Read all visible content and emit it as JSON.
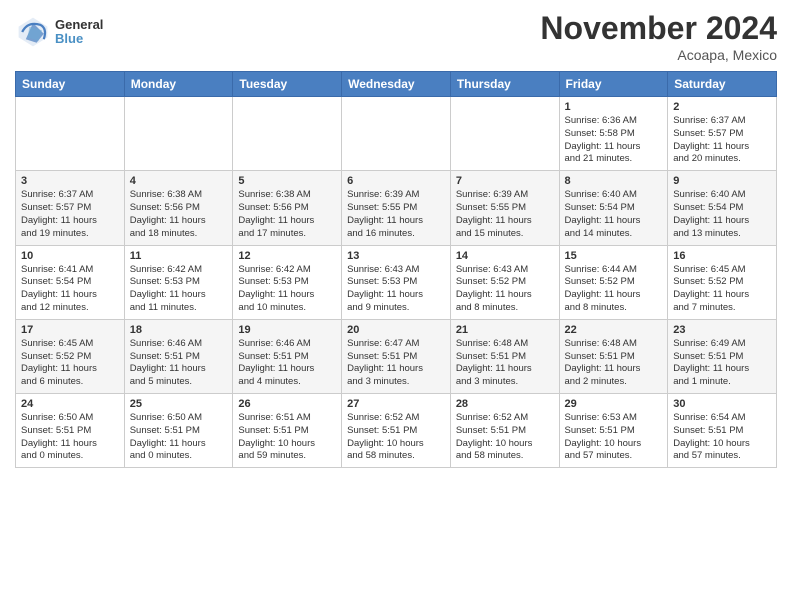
{
  "header": {
    "logo_line1": "General",
    "logo_line2": "Blue",
    "month": "November 2024",
    "location": "Acoapa, Mexico"
  },
  "weekdays": [
    "Sunday",
    "Monday",
    "Tuesday",
    "Wednesday",
    "Thursday",
    "Friday",
    "Saturday"
  ],
  "rows": [
    [
      {
        "day": "",
        "info": ""
      },
      {
        "day": "",
        "info": ""
      },
      {
        "day": "",
        "info": ""
      },
      {
        "day": "",
        "info": ""
      },
      {
        "day": "",
        "info": ""
      },
      {
        "day": "1",
        "info": "Sunrise: 6:36 AM\nSunset: 5:58 PM\nDaylight: 11 hours\nand 21 minutes."
      },
      {
        "day": "2",
        "info": "Sunrise: 6:37 AM\nSunset: 5:57 PM\nDaylight: 11 hours\nand 20 minutes."
      }
    ],
    [
      {
        "day": "3",
        "info": "Sunrise: 6:37 AM\nSunset: 5:57 PM\nDaylight: 11 hours\nand 19 minutes."
      },
      {
        "day": "4",
        "info": "Sunrise: 6:38 AM\nSunset: 5:56 PM\nDaylight: 11 hours\nand 18 minutes."
      },
      {
        "day": "5",
        "info": "Sunrise: 6:38 AM\nSunset: 5:56 PM\nDaylight: 11 hours\nand 17 minutes."
      },
      {
        "day": "6",
        "info": "Sunrise: 6:39 AM\nSunset: 5:55 PM\nDaylight: 11 hours\nand 16 minutes."
      },
      {
        "day": "7",
        "info": "Sunrise: 6:39 AM\nSunset: 5:55 PM\nDaylight: 11 hours\nand 15 minutes."
      },
      {
        "day": "8",
        "info": "Sunrise: 6:40 AM\nSunset: 5:54 PM\nDaylight: 11 hours\nand 14 minutes."
      },
      {
        "day": "9",
        "info": "Sunrise: 6:40 AM\nSunset: 5:54 PM\nDaylight: 11 hours\nand 13 minutes."
      }
    ],
    [
      {
        "day": "10",
        "info": "Sunrise: 6:41 AM\nSunset: 5:54 PM\nDaylight: 11 hours\nand 12 minutes."
      },
      {
        "day": "11",
        "info": "Sunrise: 6:42 AM\nSunset: 5:53 PM\nDaylight: 11 hours\nand 11 minutes."
      },
      {
        "day": "12",
        "info": "Sunrise: 6:42 AM\nSunset: 5:53 PM\nDaylight: 11 hours\nand 10 minutes."
      },
      {
        "day": "13",
        "info": "Sunrise: 6:43 AM\nSunset: 5:53 PM\nDaylight: 11 hours\nand 9 minutes."
      },
      {
        "day": "14",
        "info": "Sunrise: 6:43 AM\nSunset: 5:52 PM\nDaylight: 11 hours\nand 8 minutes."
      },
      {
        "day": "15",
        "info": "Sunrise: 6:44 AM\nSunset: 5:52 PM\nDaylight: 11 hours\nand 8 minutes."
      },
      {
        "day": "16",
        "info": "Sunrise: 6:45 AM\nSunset: 5:52 PM\nDaylight: 11 hours\nand 7 minutes."
      }
    ],
    [
      {
        "day": "17",
        "info": "Sunrise: 6:45 AM\nSunset: 5:52 PM\nDaylight: 11 hours\nand 6 minutes."
      },
      {
        "day": "18",
        "info": "Sunrise: 6:46 AM\nSunset: 5:51 PM\nDaylight: 11 hours\nand 5 minutes."
      },
      {
        "day": "19",
        "info": "Sunrise: 6:46 AM\nSunset: 5:51 PM\nDaylight: 11 hours\nand 4 minutes."
      },
      {
        "day": "20",
        "info": "Sunrise: 6:47 AM\nSunset: 5:51 PM\nDaylight: 11 hours\nand 3 minutes."
      },
      {
        "day": "21",
        "info": "Sunrise: 6:48 AM\nSunset: 5:51 PM\nDaylight: 11 hours\nand 3 minutes."
      },
      {
        "day": "22",
        "info": "Sunrise: 6:48 AM\nSunset: 5:51 PM\nDaylight: 11 hours\nand 2 minutes."
      },
      {
        "day": "23",
        "info": "Sunrise: 6:49 AM\nSunset: 5:51 PM\nDaylight: 11 hours\nand 1 minute."
      }
    ],
    [
      {
        "day": "24",
        "info": "Sunrise: 6:50 AM\nSunset: 5:51 PM\nDaylight: 11 hours\nand 0 minutes."
      },
      {
        "day": "25",
        "info": "Sunrise: 6:50 AM\nSunset: 5:51 PM\nDaylight: 11 hours\nand 0 minutes."
      },
      {
        "day": "26",
        "info": "Sunrise: 6:51 AM\nSunset: 5:51 PM\nDaylight: 10 hours\nand 59 minutes."
      },
      {
        "day": "27",
        "info": "Sunrise: 6:52 AM\nSunset: 5:51 PM\nDaylight: 10 hours\nand 58 minutes."
      },
      {
        "day": "28",
        "info": "Sunrise: 6:52 AM\nSunset: 5:51 PM\nDaylight: 10 hours\nand 58 minutes."
      },
      {
        "day": "29",
        "info": "Sunrise: 6:53 AM\nSunset: 5:51 PM\nDaylight: 10 hours\nand 57 minutes."
      },
      {
        "day": "30",
        "info": "Sunrise: 6:54 AM\nSunset: 5:51 PM\nDaylight: 10 hours\nand 57 minutes."
      }
    ]
  ]
}
